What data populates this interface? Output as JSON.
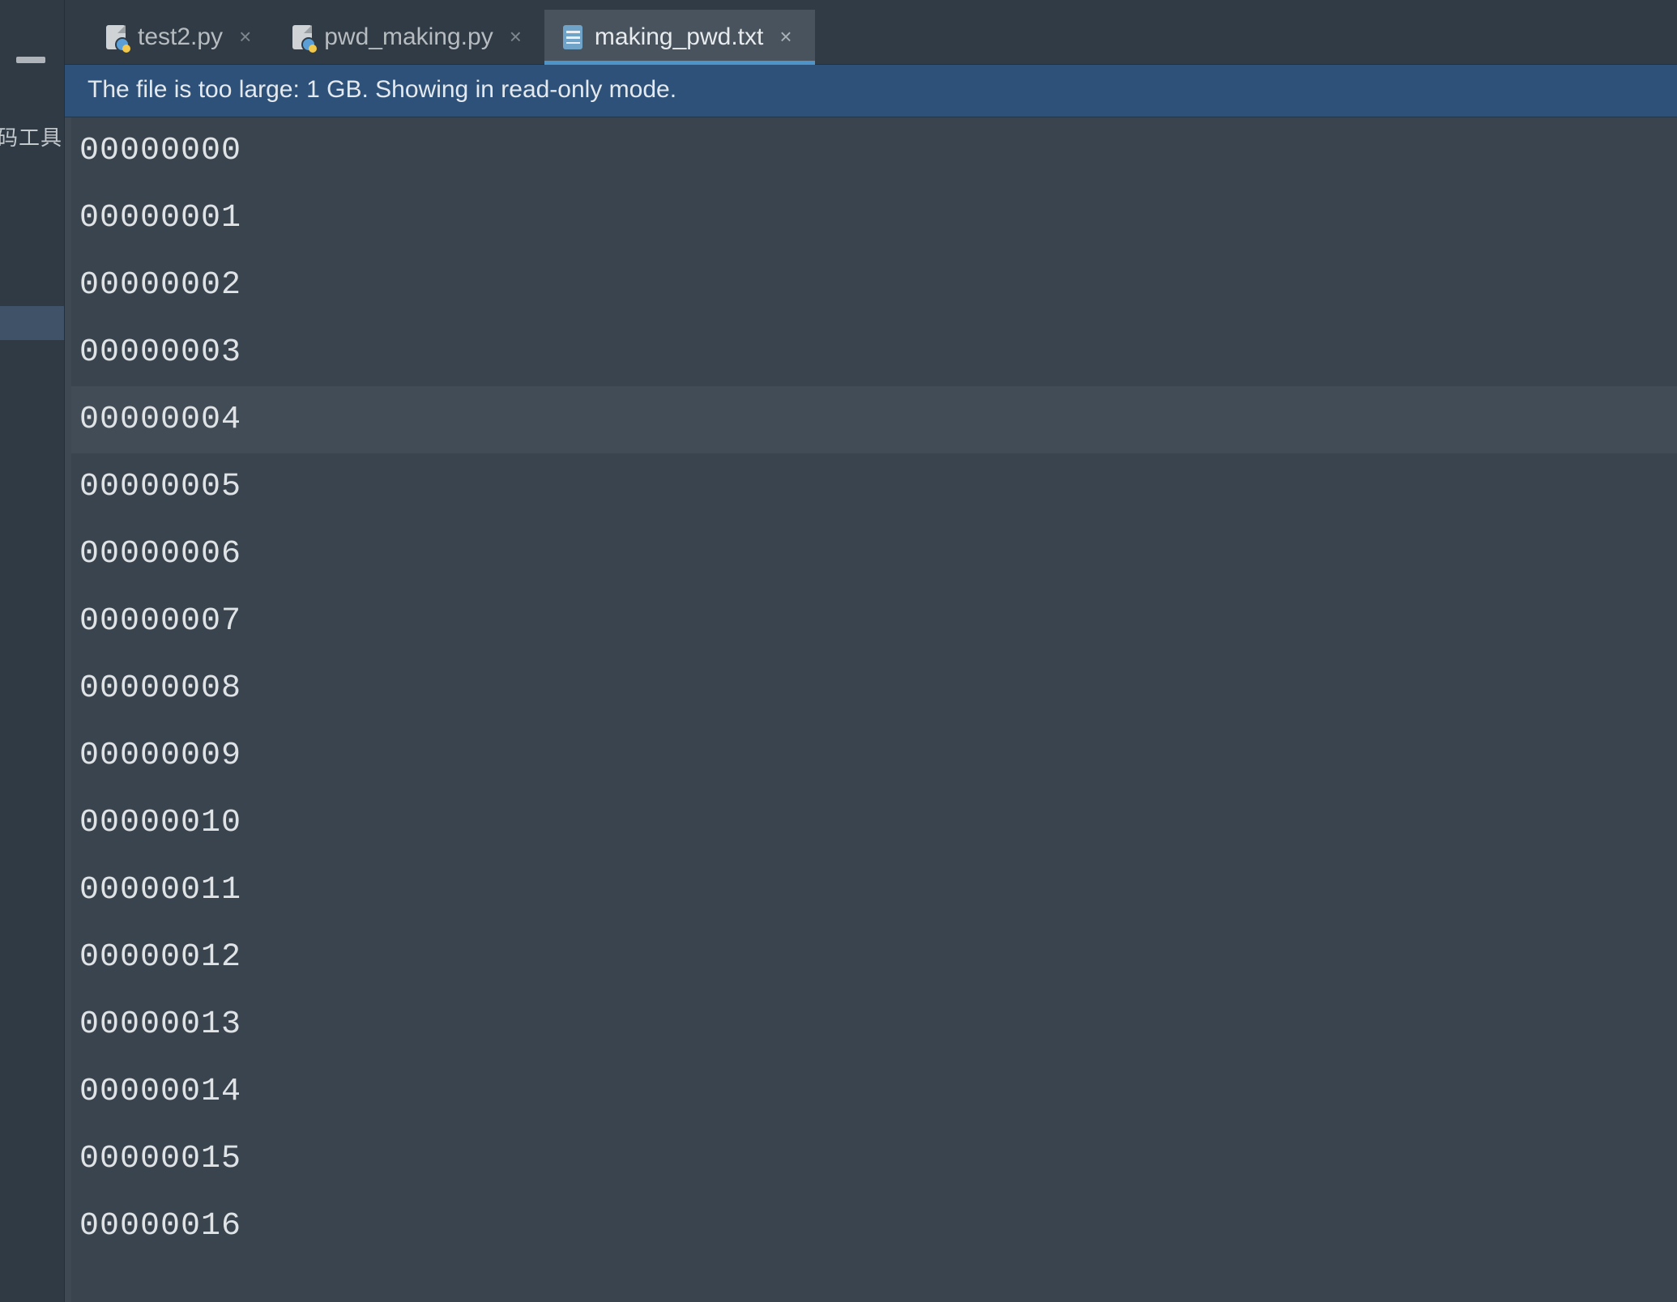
{
  "sidebar": {
    "truncated_label": "码工具"
  },
  "tabs": [
    {
      "label": "test2.py",
      "type": "py",
      "active": false
    },
    {
      "label": "pwd_making.py",
      "type": "py",
      "active": false
    },
    {
      "label": "making_pwd.txt",
      "type": "txt",
      "active": true
    }
  ],
  "banner": {
    "message": "The file is too large: 1 GB. Showing in read-only mode."
  },
  "editor": {
    "current_line_index": 4,
    "lines": [
      "00000000",
      "00000001",
      "00000002",
      "00000003",
      "00000004",
      "00000005",
      "00000006",
      "00000007",
      "00000008",
      "00000009",
      "00000010",
      "00000011",
      "00000012",
      "00000013",
      "00000014",
      "00000015",
      "00000016"
    ]
  }
}
